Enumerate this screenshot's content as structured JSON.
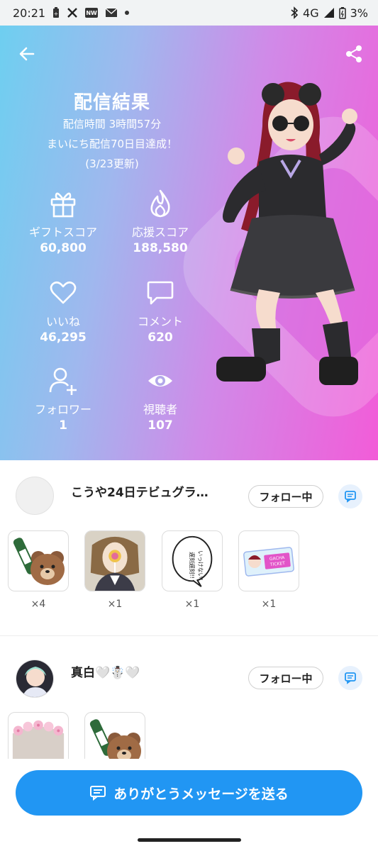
{
  "status_bar": {
    "time": "20:21",
    "network": "4G",
    "battery": "3%",
    "notification_icons": [
      "battery-saver-icon",
      "x-icon",
      "news-icon",
      "mail-icon",
      "dot-icon"
    ]
  },
  "hero": {
    "title": "配信結果",
    "duration": "配信時間 3時間57分",
    "streak": "まいにち配信70日目達成！",
    "updated": "(3/23更新)",
    "stats": [
      {
        "icon": "gift-icon",
        "label": "ギフトスコア",
        "value": "60,800"
      },
      {
        "icon": "flame-icon",
        "label": "応援スコア",
        "value": "188,580"
      },
      {
        "icon": "heart-icon",
        "label": "いいね",
        "value": "46,295"
      },
      {
        "icon": "comment-icon",
        "label": "コメント",
        "value": "620"
      },
      {
        "icon": "add-user-icon",
        "label": "フォロワー",
        "value": "1"
      },
      {
        "icon": "eye-icon",
        "label": "視聴者",
        "value": "107"
      }
    ]
  },
  "supporters": [
    {
      "name": "こうや24日テビュグラ…",
      "follow_label": "フォロー中",
      "gifts": [
        {
          "icon": "bear-sake-gift",
          "count": "×4"
        },
        {
          "icon": "lollipop-gift",
          "count": "×1"
        },
        {
          "icon": "speech-bubble-gift",
          "count": "×1"
        },
        {
          "icon": "gacha-ticket-gift",
          "count": "×1"
        }
      ],
      "ticket_text": "GACHA TICKET",
      "bubble_text": "いっけない！遅刻遅刻!!"
    },
    {
      "name": "真白🤍☃️🤍",
      "follow_label": "フォロー中",
      "gifts": [
        {
          "icon": "flower-crown-gift"
        },
        {
          "icon": "bear-sake-gift"
        }
      ]
    }
  ],
  "cta": {
    "label": "ありがとうメッセージを送る"
  },
  "colors": {
    "accent": "#2196f3",
    "hero_gradient_start": "#6ecff0",
    "hero_gradient_end": "#f25cd8"
  }
}
